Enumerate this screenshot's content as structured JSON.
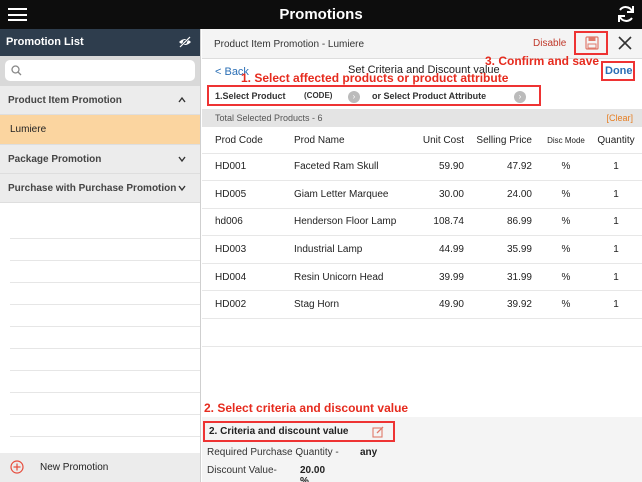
{
  "app": {
    "title": "Promotions"
  },
  "sidebar": {
    "title": "Promotion List",
    "search_placeholder": "",
    "items": [
      {
        "label": "Product Item Promotion",
        "expanded": true
      },
      {
        "label": "Lumiere",
        "selected": true
      },
      {
        "label": "Package Promotion",
        "expanded": false
      },
      {
        "label": "Purchase with Purchase Promotion",
        "expanded": false
      }
    ],
    "footer_label": "New Promotion"
  },
  "panel": {
    "header_title": "Product Item Promotion - Lumiere",
    "disable_label": "Disable",
    "back_label": "< Back",
    "subtitle": "Set Criteria and Discount value",
    "done_label": "Done",
    "select_product_label": "1.Select Product",
    "code_label": "(CODE)",
    "or_attribute_label": "or Select Product Attribute",
    "total_label": "Total Selected Products -  6",
    "clear_label": "[Clear]",
    "columns": [
      "Prod Code",
      "Prod Name",
      "Unit Cost",
      "Selling Price",
      "Disc Mode",
      "Quantity"
    ],
    "rows": [
      {
        "code": "HD001",
        "name": "Faceted Ram Skull",
        "cost": "59.90",
        "price": "47.92",
        "mode": "%",
        "qty": "1"
      },
      {
        "code": "HD005",
        "name": "Giam Letter Marquee",
        "cost": "30.00",
        "price": "24.00",
        "mode": "%",
        "qty": "1"
      },
      {
        "code": "hd006",
        "name": "Henderson Floor Lamp",
        "cost": "108.74",
        "price": "86.99",
        "mode": "%",
        "qty": "1"
      },
      {
        "code": "HD003",
        "name": "Industrial Lamp",
        "cost": "44.99",
        "price": "35.99",
        "mode": "%",
        "qty": "1"
      },
      {
        "code": "HD004",
        "name": "Resin Unicorn Head",
        "cost": "39.99",
        "price": "31.99",
        "mode": "%",
        "qty": "1"
      },
      {
        "code": "HD002",
        "name": "Stag Horn",
        "cost": "49.90",
        "price": "39.92",
        "mode": "%",
        "qty": "1"
      }
    ],
    "criteria_title": "2. Criteria and discount value",
    "req_qty_label": "Required Purchase Quantity -",
    "req_qty_value": "any",
    "discount_label": "Discount Value-",
    "discount_value": "20.00 %"
  },
  "annotations": {
    "step1": "1. Select affected products or product attribute",
    "step2": "2. Select criteria and discount value",
    "step3": "3. Confirm and save"
  },
  "colors": {
    "accent_red": "#e62b1e",
    "link_blue": "#2b6fb5",
    "selected_bg": "#fbd5a0",
    "sidebar_header": "#2e3d4d"
  }
}
